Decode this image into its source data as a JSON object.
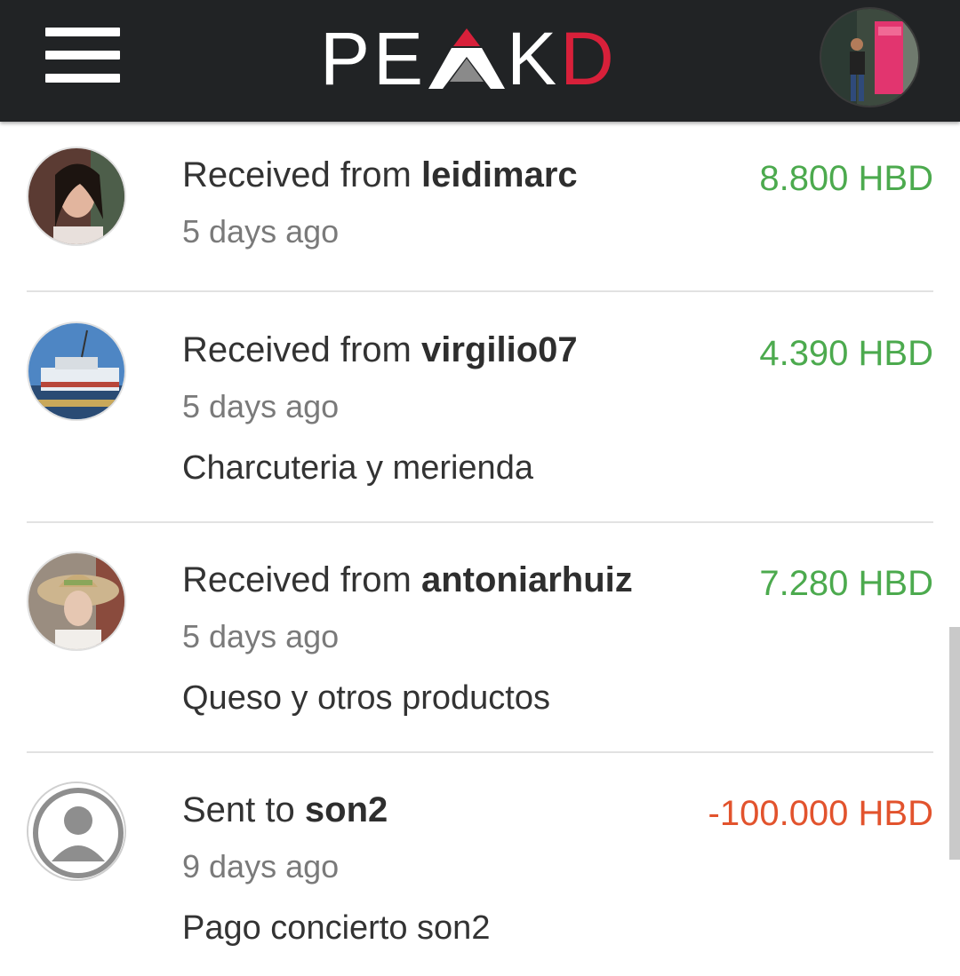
{
  "header": {
    "logo_left": "PE",
    "logo_right": "K",
    "logo_end": "D",
    "menu_icon": "hamburger-menu-icon",
    "colors": {
      "bar": "#212325",
      "logo_accent": "#d8203a"
    }
  },
  "transactions": [
    {
      "direction": "Received from",
      "user": "leidimarc",
      "time": "5 days ago",
      "amount": "8.800 HBD",
      "memo": ""
    },
    {
      "direction": "Received from",
      "user": "virgilio07",
      "time": "5 days ago",
      "amount": "4.390 HBD",
      "memo": "Charcuteria y merienda"
    },
    {
      "direction": "Received from",
      "user": "antoniarhuiz",
      "time": "5 days ago",
      "amount": "7.280 HBD",
      "memo": "Queso y otros productos"
    },
    {
      "direction": "Sent to",
      "user": "son2",
      "time": "9 days ago",
      "amount": "-100.000 HBD",
      "memo": "Pago concierto son2"
    }
  ],
  "colors": {
    "received": "#4caa4e",
    "sent": "#e2532d"
  }
}
